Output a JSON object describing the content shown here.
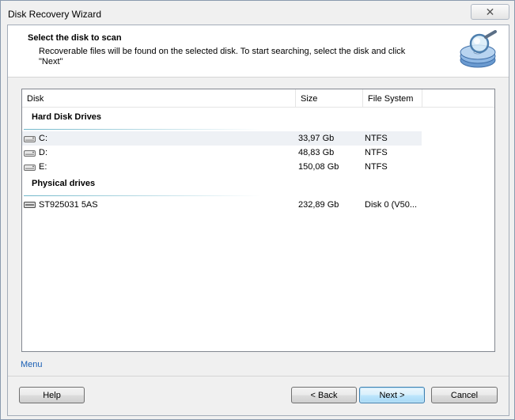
{
  "window": {
    "title": "Disk Recovery Wizard"
  },
  "header": {
    "title": "Select the disk to scan",
    "description": "Recoverable files will be found on the selected disk. To start searching, select the disk and click \"Next\""
  },
  "list": {
    "columns": [
      "Disk",
      "Size",
      "File System"
    ],
    "groups": [
      {
        "label": "Hard Disk Drives",
        "rows": [
          {
            "name": "C:",
            "size": "33,97 Gb",
            "fs": "NTFS"
          },
          {
            "name": "D:",
            "size": "48,83 Gb",
            "fs": "NTFS"
          },
          {
            "name": "E:",
            "size": "150,08 Gb",
            "fs": "NTFS"
          }
        ]
      },
      {
        "label": "Physical drives",
        "rows": [
          {
            "name": "ST925031 5AS",
            "size": "232,89 Gb",
            "fs": "Disk 0 (V50..."
          }
        ]
      }
    ]
  },
  "footer": {
    "menu_label": "Menu",
    "help_label": "Help",
    "back_label": "< Back",
    "next_label": "Next >",
    "cancel_label": "Cancel"
  },
  "icons": {
    "wizard": "magnifier-over-disks-icon",
    "drive": "hard-drive-icon",
    "close": "close-icon"
  },
  "colors": {
    "link": "#1a5fb4",
    "group_line": "#6fb6c9",
    "default_button": "#3c7fb1"
  }
}
